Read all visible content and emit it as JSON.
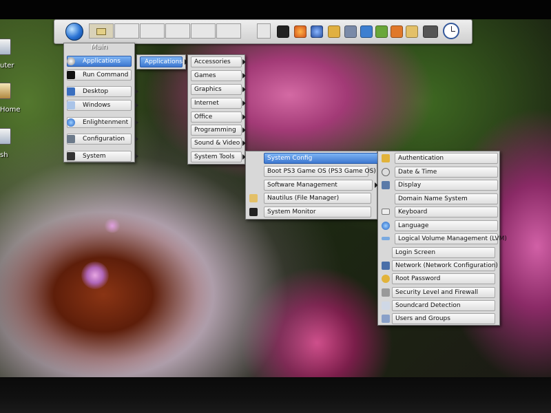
{
  "desktop": {
    "icons": [
      {
        "label": "uter"
      },
      {
        "label": "Home"
      },
      {
        "label": "sh"
      }
    ]
  },
  "main_menu": {
    "title": "Main",
    "items": [
      {
        "label": "Applications",
        "icon": "applications-icon"
      },
      {
        "label": "Run Command",
        "icon": "terminal-icon"
      },
      {
        "label": "Desktop",
        "icon": "desktop-icon"
      },
      {
        "label": "Windows",
        "icon": "windows-icon"
      },
      {
        "label": "Enlightenment",
        "icon": "enlightenment-icon"
      },
      {
        "label": "Configuration",
        "icon": "configuration-icon"
      },
      {
        "label": "System",
        "icon": "system-icon"
      }
    ]
  },
  "applications_menu": {
    "items": [
      {
        "label": "Applications"
      }
    ]
  },
  "categories_menu": {
    "items": [
      {
        "label": "Accessories"
      },
      {
        "label": "Games"
      },
      {
        "label": "Graphics"
      },
      {
        "label": "Internet"
      },
      {
        "label": "Office"
      },
      {
        "label": "Programming"
      },
      {
        "label": "Sound & Video"
      },
      {
        "label": "System Tools"
      }
    ]
  },
  "system_tools_menu": {
    "items": [
      {
        "label": "System Config"
      },
      {
        "label": "Boot PS3 Game OS (PS3 Game OS)"
      },
      {
        "label": "Software Management"
      },
      {
        "label": "Nautilus (File Manager)"
      },
      {
        "label": "System Monitor"
      }
    ]
  },
  "system_config_menu": {
    "items": [
      {
        "label": "Authentication"
      },
      {
        "label": "Date & Time"
      },
      {
        "label": "Display"
      },
      {
        "label": "Domain Name System"
      },
      {
        "label": "Keyboard"
      },
      {
        "label": "Language"
      },
      {
        "label": "Logical Volume Management (LVM)"
      },
      {
        "label": "Login Screen"
      },
      {
        "label": "Network (Network Configuration)"
      },
      {
        "label": "Root Password"
      },
      {
        "label": "Security Level and Firewall"
      },
      {
        "label": "Soundcard Detection"
      },
      {
        "label": "Users and Groups"
      }
    ]
  },
  "taskbar": {
    "launchers": [
      "terminal-icon",
      "firefox-icon",
      "thunderbird-icon",
      "chat-icon",
      "tools-icon",
      "document-icon",
      "spreadsheet-icon",
      "presentation-icon",
      "folder-icon",
      "camera-icon"
    ]
  },
  "colors": {
    "menu_bg": "#d8d8d8",
    "selected": "#3d78d0"
  }
}
